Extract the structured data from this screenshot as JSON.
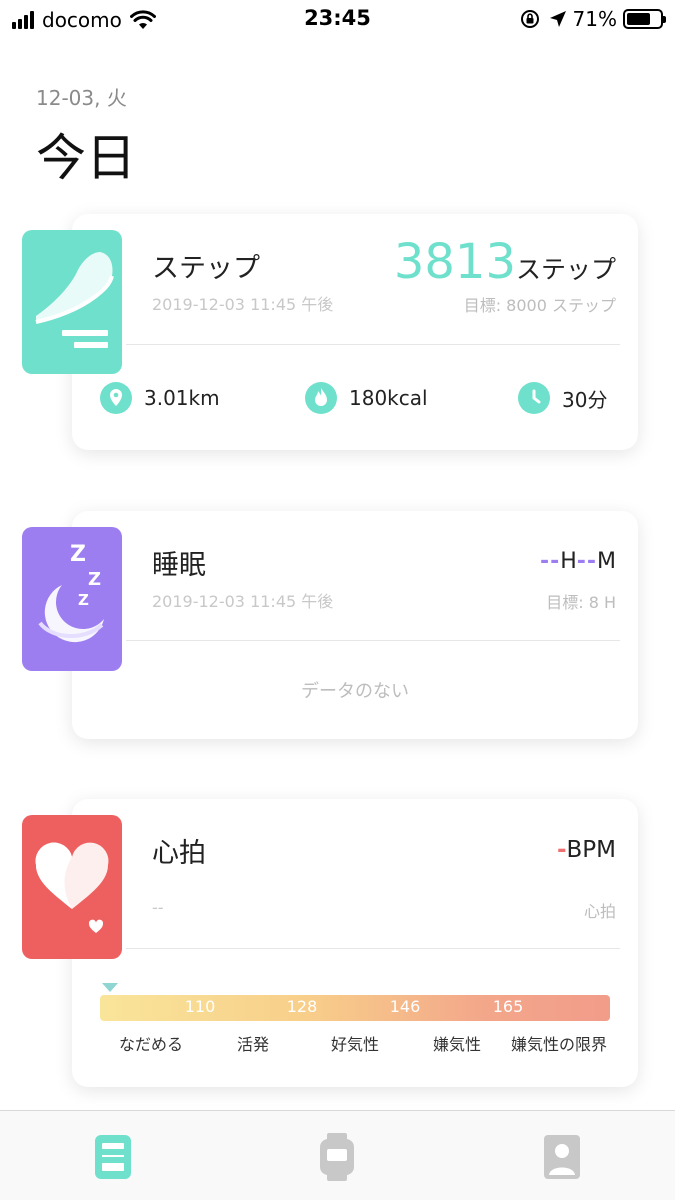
{
  "status_bar": {
    "carrier": "docomo",
    "time": "23:45",
    "battery_percent": "71%",
    "battery_level": 0.71,
    "icons": [
      "signal-icon",
      "wifi-icon",
      "orientation-lock-icon",
      "location-arrow-icon",
      "battery-icon"
    ]
  },
  "header": {
    "date": "12-03, 火",
    "title": "今日"
  },
  "steps_card": {
    "icon": "sneaker-icon",
    "title": "ステップ",
    "timestamp": "2019-12-03 11:45 午後",
    "value": "3813",
    "unit": "ステップ",
    "goal": "目標: 8000  ステップ",
    "metrics": [
      {
        "icon": "location-pin-icon",
        "value": "3.01km"
      },
      {
        "icon": "flame-icon",
        "value": "180kcal"
      },
      {
        "icon": "clock-icon",
        "value": "30分"
      }
    ],
    "accent_color": "#6fe0cc"
  },
  "sleep_card": {
    "icon": "moon-zzz-icon",
    "title": "睡眠",
    "timestamp": "2019-12-03 11:45 午後",
    "hours_placeholder": "--",
    "hours_unit": "H",
    "minutes_placeholder": "--",
    "minutes_unit": "M",
    "goal": "目標: 8 H",
    "empty_text": "データのない",
    "accent_color": "#9d7ef0"
  },
  "heart_card": {
    "icon": "heart-icon",
    "title": "心拍",
    "bpm_placeholder": "-",
    "bpm_unit": "BPM",
    "timestamp": "--",
    "sub_label": "心拍",
    "zone_ticks": [
      "110",
      "128",
      "146",
      "165"
    ],
    "zones": [
      "なだめる",
      "活発",
      "好気性",
      "嫌気性",
      "嫌気性の限界"
    ],
    "accent_color": "#ee6060"
  },
  "tab_bar": {
    "tabs": [
      {
        "name": "today",
        "icon": "dashboard-icon",
        "active": true
      },
      {
        "name": "device",
        "icon": "watch-icon",
        "active": false
      },
      {
        "name": "profile",
        "icon": "profile-icon",
        "active": false
      }
    ],
    "active_color": "#6fe0cc",
    "inactive_color": "#c8c8c8"
  }
}
